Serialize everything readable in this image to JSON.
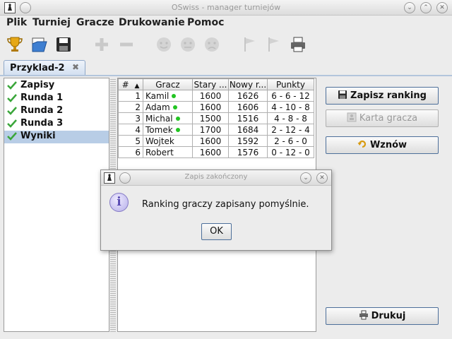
{
  "window": {
    "title": "OSwiss - manager turniejów"
  },
  "menu": [
    "Plik",
    "Turniej",
    "Gracze",
    "Drukowanie",
    "Pomoc"
  ],
  "toolbar": {
    "icons": [
      "trophy-icon",
      "open-file-icon",
      "save-icon",
      "add-icon",
      "remove-icon",
      "face-icon",
      "face-icon",
      "face-icon",
      "flag-icon",
      "flag-icon",
      "print-icon"
    ]
  },
  "tab": {
    "label": "Przyklad-2",
    "close": "✖"
  },
  "tree": {
    "items": [
      {
        "label": "Zapisy"
      },
      {
        "label": "Runda 1"
      },
      {
        "label": "Runda 2"
      },
      {
        "label": "Runda 3"
      },
      {
        "label": "Wyniki"
      }
    ],
    "selected": "Wyniki"
  },
  "table": {
    "headers": [
      "#",
      "Gracz",
      "Stary ...",
      "Nowy r...",
      "Punkty"
    ],
    "sort_indicator": "▲",
    "rows": [
      {
        "n": "1",
        "player": "Kamil",
        "active": true,
        "old": "1600",
        "new": "1626",
        "points": "6 - 6 - 12"
      },
      {
        "n": "2",
        "player": "Adam",
        "active": true,
        "old": "1600",
        "new": "1606",
        "points": "4 - 10 - 8"
      },
      {
        "n": "3",
        "player": "Michal",
        "active": true,
        "old": "1500",
        "new": "1516",
        "points": "4 - 8 - 8"
      },
      {
        "n": "4",
        "player": "Tomek",
        "active": true,
        "old": "1700",
        "new": "1684",
        "points": "2 - 12 - 4"
      },
      {
        "n": "5",
        "player": "Wojtek",
        "active": false,
        "old": "1600",
        "new": "1592",
        "points": "2 - 6 - 0"
      },
      {
        "n": "6",
        "player": "Robert",
        "active": false,
        "old": "1600",
        "new": "1576",
        "points": "0 - 12 - 0"
      }
    ]
  },
  "panel": {
    "save_ranking": "Zapisz ranking",
    "player_card": "Karta gracza",
    "resume": "Wznów",
    "print": "Drukuj"
  },
  "dialog": {
    "title": "Zapis zakończony",
    "message": "Ranking graczy zapisany pomyślnie.",
    "ok": "OK"
  },
  "colors": {
    "selection": "#b8cde6",
    "active_dot": "#22c422",
    "button_border": "#4d6f9a"
  }
}
